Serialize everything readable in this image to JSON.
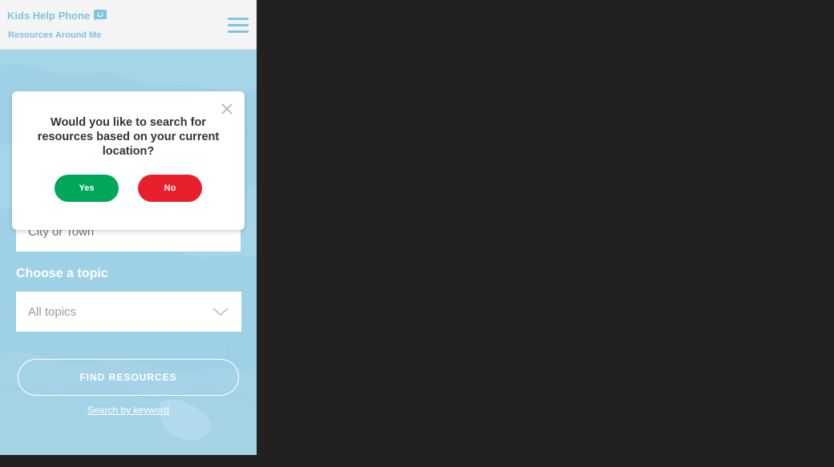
{
  "header": {
    "brand": "Kids Help Phone",
    "subtitle": "Resources Around Me",
    "brand_icon": "smiley-chat-icon",
    "menu_icon": "hamburger-menu-icon"
  },
  "search": {
    "location_placeholder": "City or Town",
    "topic_label": "Choose a topic",
    "topic_selected": "All topics",
    "find_button": "FIND RESOURCES",
    "keyword_link": "Search by keyword"
  },
  "modal": {
    "question": "Would you like to search for resources based on your current location?",
    "yes_label": "Yes",
    "no_label": "No"
  },
  "colors": {
    "brand_blue": "#7fc4e0",
    "map_water": "#9fd1e6",
    "yes_green": "#00a65a",
    "no_red": "#e8202e",
    "background_dark": "#222120"
  }
}
